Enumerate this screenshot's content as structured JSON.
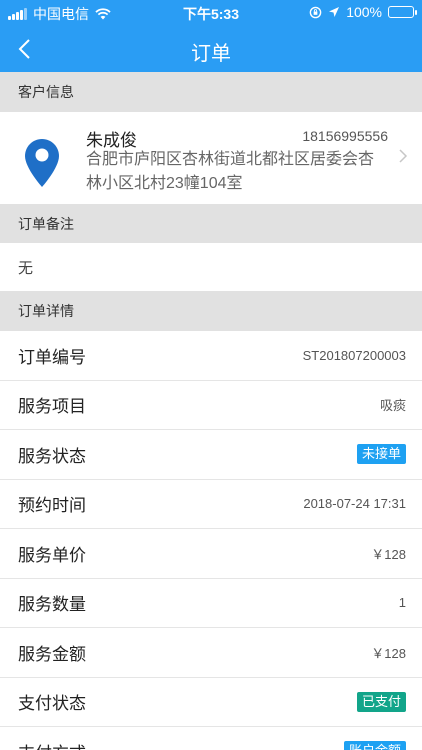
{
  "status_bar": {
    "carrier": "中国电信",
    "time": "下午5:33",
    "battery": "100%"
  },
  "nav": {
    "title": "订单"
  },
  "sections": {
    "customer": "客户信息",
    "remark": "订单备注",
    "details": "订单详情"
  },
  "customer": {
    "name": "朱成俊",
    "phone": "18156995556",
    "address": "合肥市庐阳区杏林街道北都社区居委会杏林小区北村23幢104室"
  },
  "remark": {
    "text": "无"
  },
  "details": [
    {
      "label": "订单编号",
      "value": "ST201807200003",
      "badge": ""
    },
    {
      "label": "服务项目",
      "value": "吸痰",
      "badge": ""
    },
    {
      "label": "服务状态",
      "value": "未接单",
      "badge": "blue"
    },
    {
      "label": "预约时间",
      "value": "2018-07-24 17:31",
      "badge": ""
    },
    {
      "label": "服务单价",
      "value": "￥128",
      "badge": ""
    },
    {
      "label": "服务数量",
      "value": "1",
      "badge": ""
    },
    {
      "label": "服务金额",
      "value": "￥128",
      "badge": ""
    },
    {
      "label": "支付状态",
      "value": "已支付",
      "badge": "green"
    },
    {
      "label": "支付方式",
      "value": "账户余额",
      "badge": "blue"
    }
  ],
  "colors": {
    "primary": "#2a9df4",
    "badge_blue": "#1ea1f2",
    "badge_green": "#12a58a"
  }
}
